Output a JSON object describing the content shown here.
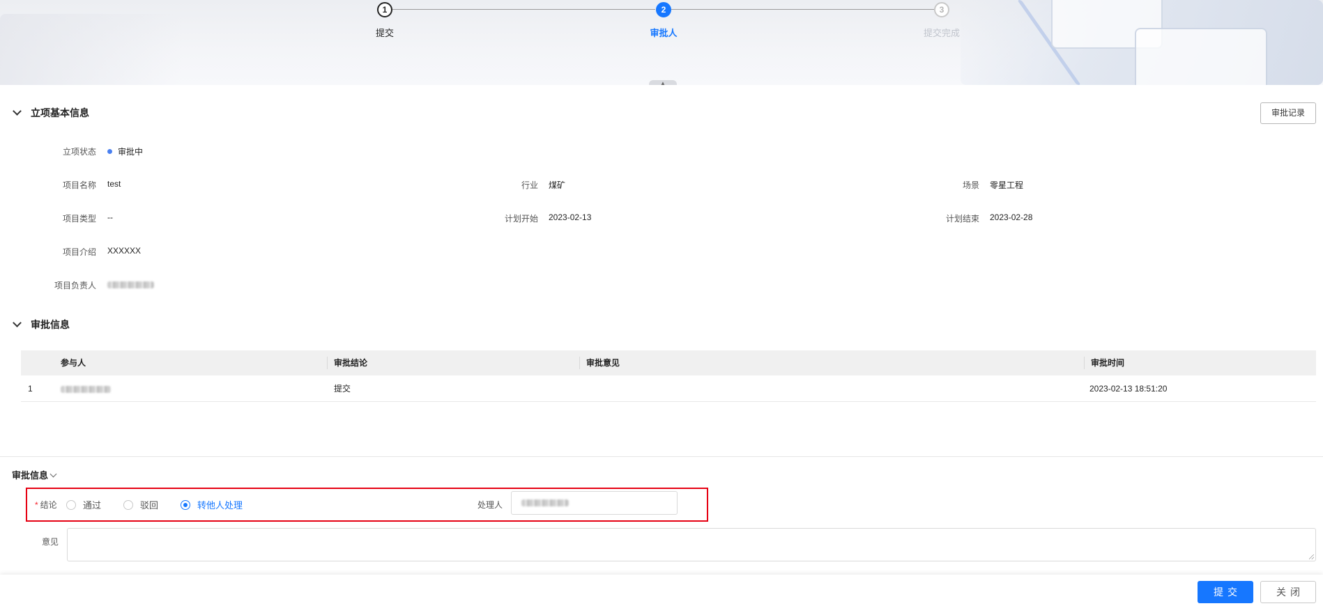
{
  "steps": [
    {
      "number": "1",
      "label": "提交",
      "state": "done"
    },
    {
      "number": "2",
      "label": "审批人",
      "state": "active"
    },
    {
      "number": "3",
      "label": "提交完成",
      "state": "wait"
    }
  ],
  "basic_info": {
    "section_title": "立项基本信息",
    "record_button": "审批记录",
    "fields": {
      "status_label": "立项状态",
      "status_value": "审批中",
      "name_label": "项目名称",
      "name_value": "test",
      "industry_label": "行业",
      "industry_value": "煤矿",
      "scene_label": "场景",
      "scene_value": "零星工程",
      "type_label": "项目类型",
      "type_value": "--",
      "plan_start_label": "计划开始",
      "plan_start_value": "2023-02-13",
      "plan_end_label": "计划结束",
      "plan_end_value": "2023-02-28",
      "intro_label": "项目介绍",
      "intro_value": "XXXXXX",
      "owner_label": "项目负责人"
    }
  },
  "approval_info": {
    "section_title": "审批信息",
    "columns": [
      "参与人",
      "审批结论",
      "审批意见",
      "审批时间"
    ],
    "rows": [
      {
        "index": "1",
        "conclusion": "提交",
        "opinion": "",
        "time": "2023-02-13 18:51:20"
      }
    ]
  },
  "approval_form": {
    "title": "审批信息",
    "conclusion_label": "结论",
    "options": [
      "通过",
      "驳回",
      "转他人处理"
    ],
    "selected_option": "转他人处理",
    "handler_label": "处理人",
    "opinion_label": "意见",
    "opinion_value": ""
  },
  "footer": {
    "submit_label": "提交",
    "close_label": "关闭"
  },
  "colors": {
    "primary": "#1677ff",
    "highlight_border": "#e60012",
    "status_dot": "#4a80f0"
  }
}
